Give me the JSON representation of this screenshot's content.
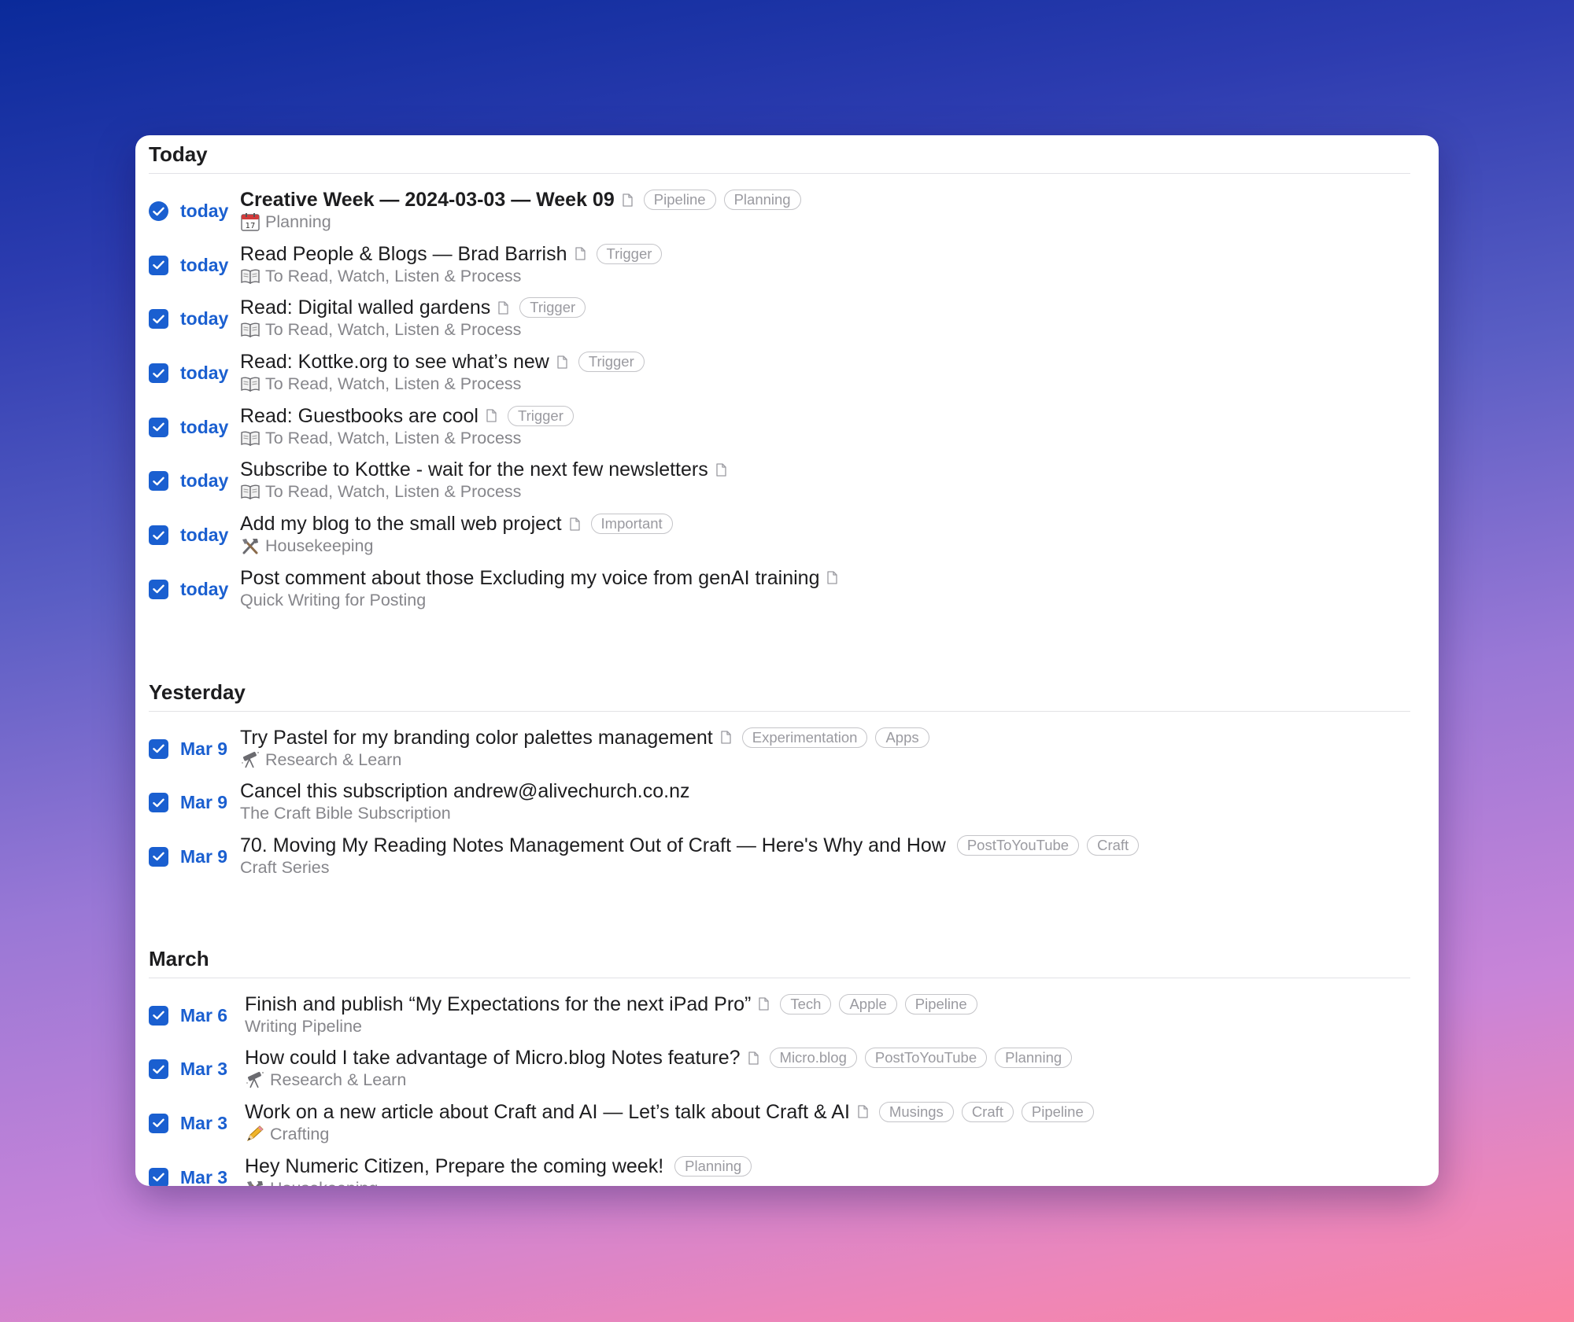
{
  "colors": {
    "accent": "#1a5fd0",
    "title_text": "#1d1d1f",
    "secondary_text": "#86868b",
    "tag_text": "#9a9aa0",
    "tag_border": "#c4c4c8"
  },
  "sections": [
    {
      "title": "Today",
      "items": [
        {
          "date": "today",
          "title": "Creative Week — 2024-03-03 — Week 09",
          "bold": true,
          "doc": true,
          "tags": [
            "Pipeline",
            "Planning"
          ],
          "icon": "calendar-icon",
          "subtitle": "Planning"
        },
        {
          "date": "today",
          "title": "Read People & Blogs — Brad Barrish",
          "doc": true,
          "tags": [
            "Trigger"
          ],
          "icon": "book-icon",
          "subtitle": "To Read, Watch, Listen & Process"
        },
        {
          "date": "today",
          "title": "Read: Digital walled gardens",
          "doc": true,
          "tags": [
            "Trigger"
          ],
          "icon": "book-icon",
          "subtitle": "To Read, Watch, Listen & Process"
        },
        {
          "date": "today",
          "title": "Read: Kottke.org to see what’s new",
          "doc": true,
          "tags": [
            "Trigger"
          ],
          "icon": "book-icon",
          "subtitle": "To Read, Watch, Listen & Process"
        },
        {
          "date": "today",
          "title": "Read: Guestbooks are cool",
          "doc": true,
          "tags": [
            "Trigger"
          ],
          "icon": "book-icon",
          "subtitle": "To Read, Watch, Listen & Process"
        },
        {
          "date": "today",
          "title": "Subscribe to Kottke - wait for the next few newsletters",
          "doc": true,
          "tags": [],
          "icon": "book-icon",
          "subtitle": "To Read, Watch, Listen & Process"
        },
        {
          "date": "today",
          "title": "Add my blog to the small web project",
          "doc": true,
          "tags": [
            "Important"
          ],
          "icon": "tools-icon",
          "subtitle": "Housekeeping"
        },
        {
          "date": "today",
          "title": "Post comment about those Excluding my voice from genAI training ",
          "doc": true,
          "tags": [],
          "icon": "",
          "subtitle": "Quick Writing for Posting"
        }
      ]
    },
    {
      "title": "Yesterday",
      "items": [
        {
          "date": "Mar 9",
          "title": "Try Pastel for my branding color palettes management",
          "doc": true,
          "tags": [
            "Experimentation",
            "Apps"
          ],
          "icon": "telescope-icon",
          "subtitle": "Research & Learn"
        },
        {
          "date": "Mar 9",
          "title": "Cancel this subscription andrew@alivechurch.co.nz",
          "doc": false,
          "tags": [],
          "icon": "",
          "subtitle": "The Craft Bible Subscription"
        },
        {
          "date": "Mar 9",
          "title": "70. Moving My Reading Notes Management Out of Craft — Here's Why and How",
          "doc": false,
          "tags": [
            "PostToYouTube",
            "Craft"
          ],
          "icon": "",
          "subtitle": "Craft Series"
        }
      ]
    },
    {
      "title": "March",
      "items": [
        {
          "date": "Mar 6",
          "title": "Finish and publish “My Expectations for the next iPad Pro”",
          "doc": true,
          "tags": [
            "Tech",
            "Apple",
            "Pipeline"
          ],
          "icon": "",
          "subtitle": "Writing Pipeline"
        },
        {
          "date": "Mar 3",
          "title": "How could I take advantage of Micro.blog Notes feature?",
          "doc": true,
          "tags": [
            "Micro.blog",
            "PostToYouTube",
            "Planning"
          ],
          "icon": "telescope-icon",
          "subtitle": "Research & Learn"
        },
        {
          "date": "Mar 3",
          "title": "Work on a new article about Craft and AI — Let’s talk about Craft & AI",
          "doc": true,
          "tags": [
            "Musings",
            "Craft",
            "Pipeline"
          ],
          "icon": "pencil-icon",
          "subtitle": "Crafting"
        },
        {
          "date": "Mar 3",
          "title": "Hey Numeric Citizen, Prepare the coming week!",
          "doc": false,
          "tags": [
            "Planning"
          ],
          "icon": "tools-icon",
          "subtitle": "Housekeeping"
        }
      ]
    }
  ]
}
